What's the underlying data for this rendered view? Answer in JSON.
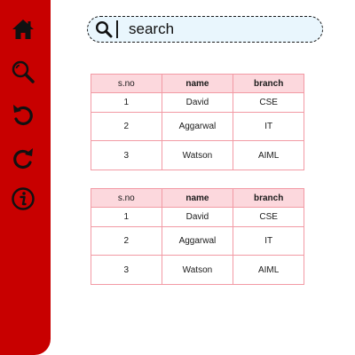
{
  "sidebar": {
    "background": "#c80000",
    "icons": [
      "home-icon",
      "zoom-icon",
      "undo-icon",
      "redo-icon",
      "info-icon"
    ]
  },
  "search": {
    "placeholder": "search",
    "background": "#e9f6fd"
  },
  "tables": [
    {
      "headers": [
        "s.no",
        "name",
        "branch"
      ],
      "rows": [
        [
          "1",
          "David",
          "CSE"
        ],
        [
          "2",
          "Aggarwal",
          "IT"
        ],
        [
          "3",
          "Watson",
          "AIML"
        ]
      ]
    },
    {
      "headers": [
        "s.no",
        "name",
        "branch"
      ],
      "rows": [
        [
          "1",
          "David",
          "CSE"
        ],
        [
          "2",
          "Aggarwal",
          "IT"
        ],
        [
          "3",
          "Watson",
          "AIML"
        ]
      ]
    }
  ],
  "colors": {
    "header_fill": "#fcd8dd",
    "table_border": "#f29aa4"
  }
}
